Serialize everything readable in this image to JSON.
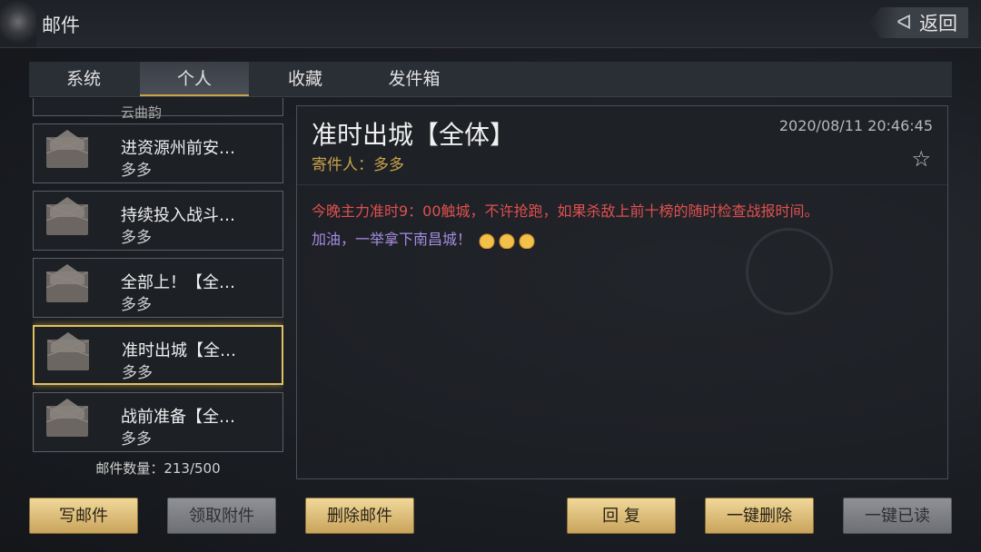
{
  "header": {
    "title": "邮件",
    "back_label": "返回"
  },
  "tabs": [
    {
      "label": "系统",
      "active": false
    },
    {
      "label": "个人",
      "active": true
    },
    {
      "label": "收藏",
      "active": false
    },
    {
      "label": "发件箱",
      "active": false
    }
  ],
  "mails": [
    {
      "subject": "云曲韵",
      "sender": "",
      "partial": true,
      "selected": false
    },
    {
      "subject": "进资源州前安…",
      "sender": "多多",
      "selected": false
    },
    {
      "subject": "持续投入战斗…",
      "sender": "多多",
      "selected": false
    },
    {
      "subject": "全部上！【全…",
      "sender": "多多",
      "selected": false
    },
    {
      "subject": "准时出城【全…",
      "sender": "多多",
      "selected": true
    },
    {
      "subject": "战前准备【全…",
      "sender": "多多",
      "selected": false
    }
  ],
  "mail_count": "邮件数量：213/500",
  "detail": {
    "title": "准时出城【全体】",
    "sender": "寄件人：多多",
    "date": "2020/08/11   20:46:45",
    "body_line1": "今晚主力准时9：00触城，不许抢跑，如果杀敌上前十榜的随时检查战报时间。",
    "body_line2": "加油，一举拿下南昌城！"
  },
  "buttons": {
    "write": "写邮件",
    "claim": "领取附件",
    "delete": "删除邮件",
    "reply": "回 复",
    "delete_all": "一键删除",
    "read_all": "一键已读"
  }
}
